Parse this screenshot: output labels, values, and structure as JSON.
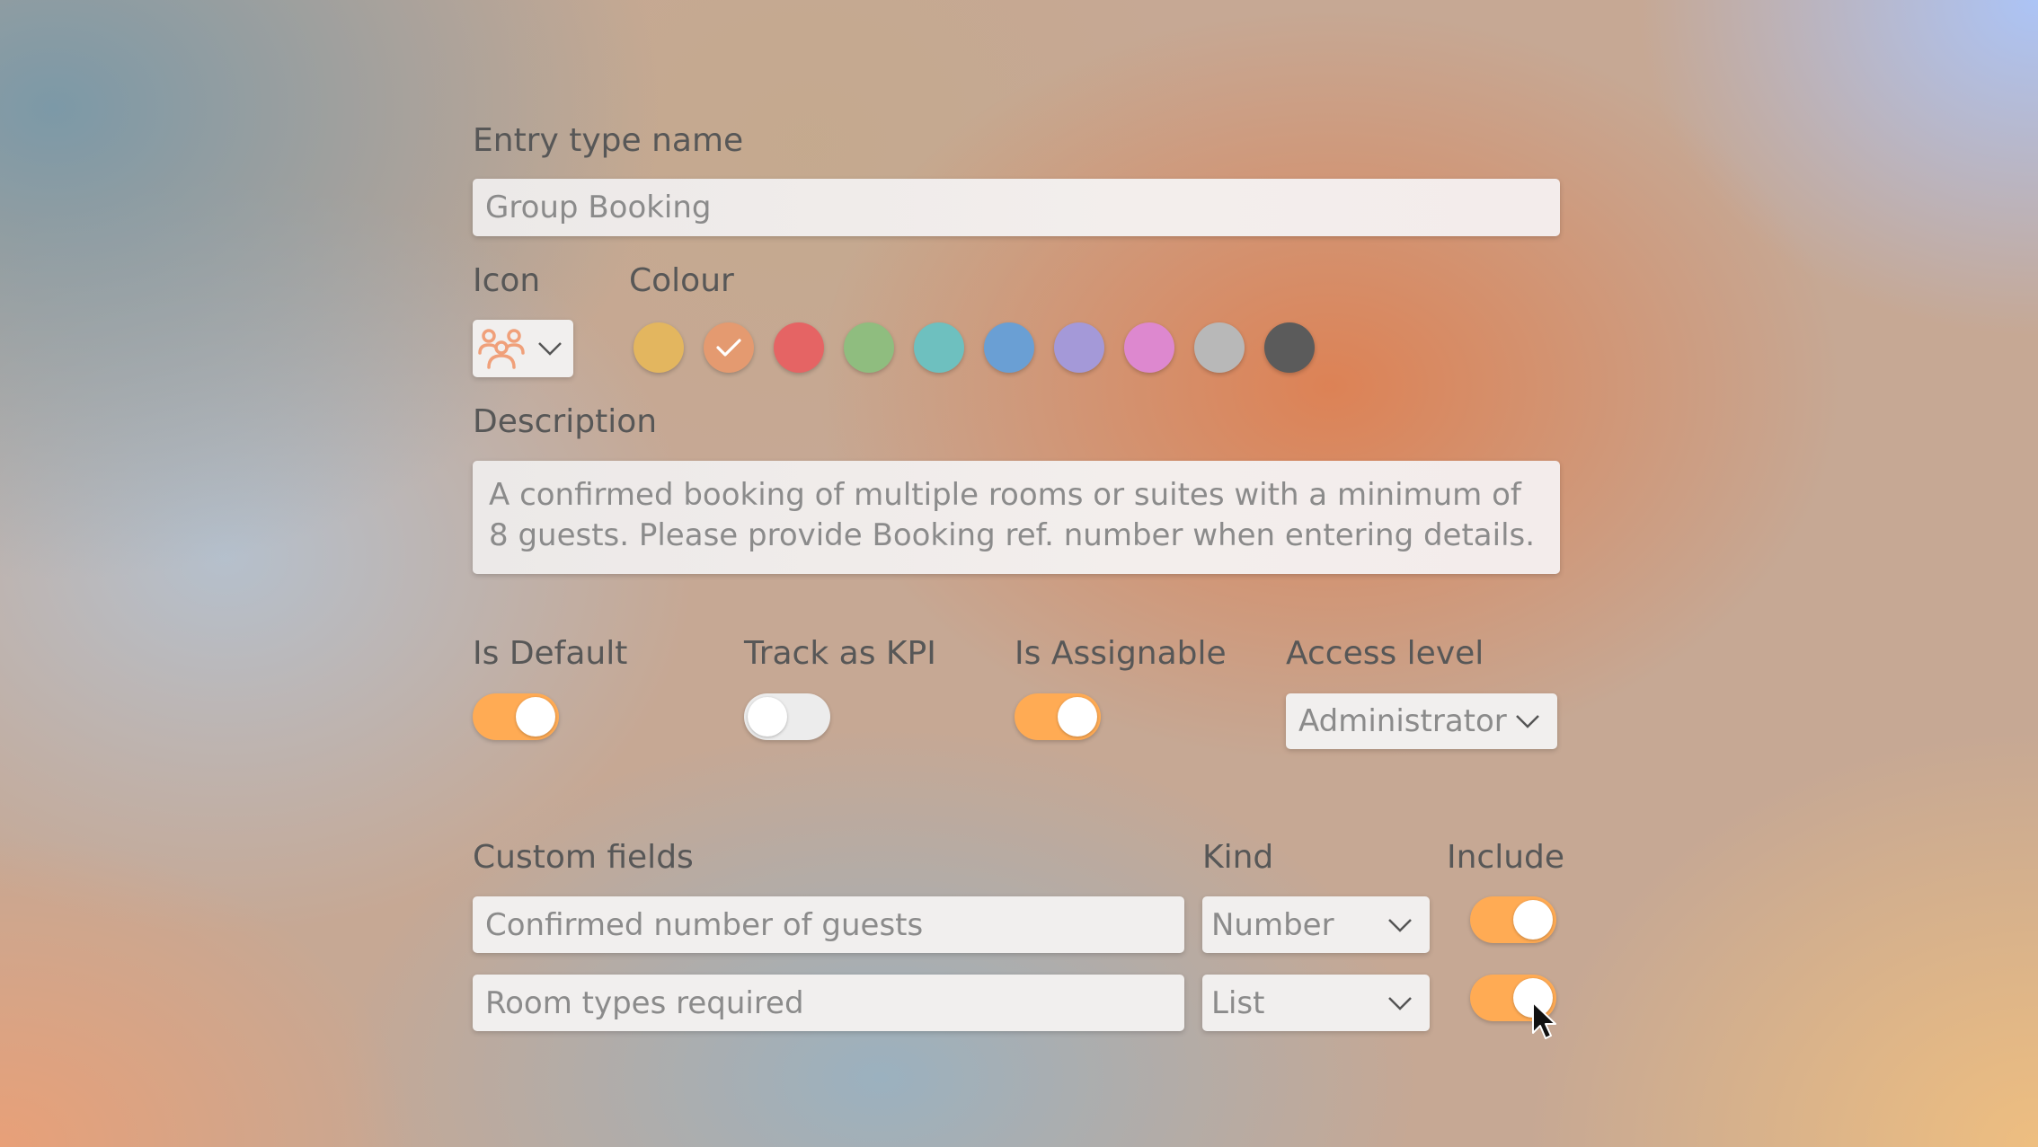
{
  "form": {
    "entry_type_name": {
      "label": "Entry type name",
      "value": "Group Booking"
    },
    "icon": {
      "label": "Icon",
      "selected_icon": "group-people-icon"
    },
    "colour": {
      "label": "Colour",
      "swatches": [
        "#e3b65f",
        "#e49a70",
        "#e56464",
        "#8fbd7f",
        "#6ec0bf",
        "#6a9fd4",
        "#a499d8",
        "#dd88cf",
        "#b8b8b8",
        "#5b5b5b"
      ],
      "selected_index": 1
    },
    "description": {
      "label": "Description",
      "value": "A confirmed booking of multiple rooms or suites with a minimum of 8 guests. Please provide Booking ref. number when entering details."
    },
    "is_default": {
      "label": "Is Default",
      "on": true
    },
    "track_kpi": {
      "label": "Track as KPI",
      "on": false
    },
    "is_assignable": {
      "label": "Is Assignable",
      "on": true
    },
    "access_level": {
      "label": "Access level",
      "value": "Administrator"
    }
  },
  "custom_fields": {
    "label": "Custom fields",
    "kind_label": "Kind",
    "include_label": "Include",
    "rows": [
      {
        "name": "Confirmed number of guests",
        "kind": "Number",
        "include": true
      },
      {
        "name": "Room types required",
        "kind": "List",
        "include": true
      }
    ]
  },
  "colors": {
    "accent": "#ffab54",
    "toggle_off": "#ececec",
    "icon_color": "#f0a07a"
  }
}
